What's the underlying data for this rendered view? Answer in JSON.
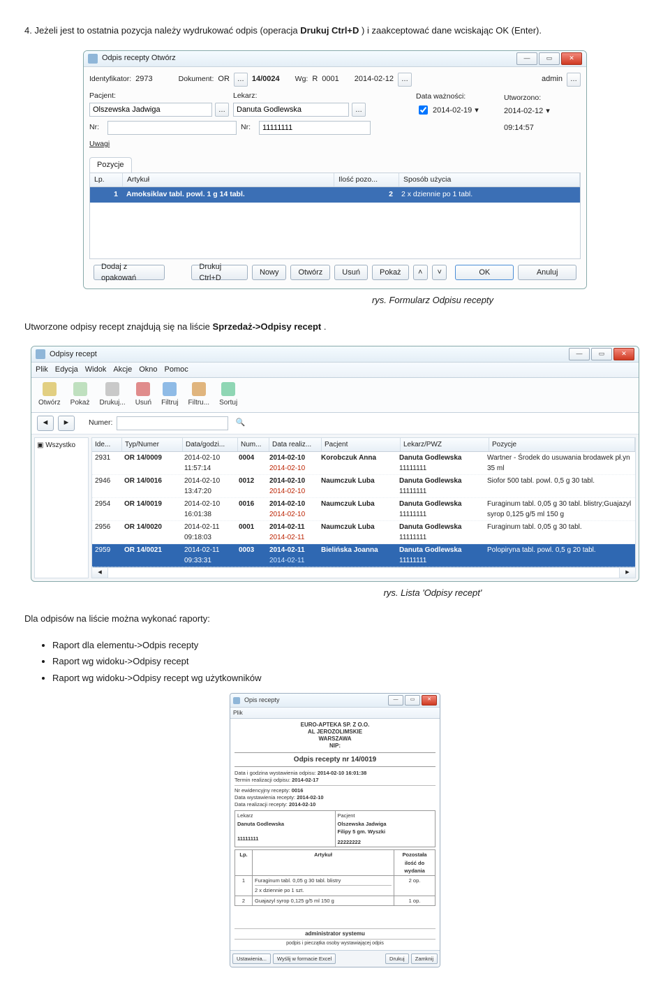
{
  "intro": {
    "prefix": "4. Jeżeli jest to ostatnia pozycja należy wydrukować odpis (operacja ",
    "op": "Drukuj Ctrl+D",
    "suffix": ") i zaakceptować dane wciskając OK (Enter)."
  },
  "form_window": {
    "title": "Odpis recepty Otwórz",
    "ident_label": "Identyfikator:",
    "ident_val": "2973",
    "dok_label": "Dokument:",
    "dok_type": "OR",
    "dok_num": "14/0024",
    "wg_label": "Wg:",
    "wg_type": "R",
    "wg_num": "0001",
    "wg_date": "2014-02-12",
    "user": "admin",
    "pacjent_lbl": "Pacjent:",
    "pacjent_val": "Olszewska Jadwiga",
    "lekarz_lbl": "Lekarz:",
    "lekarz_val": "Danuta Godlewska",
    "datawaz_lbl": "Data ważności:",
    "datawaz_val": "2014-02-19",
    "utw_lbl": "Utworzono:",
    "utw_date": "2014-02-12",
    "utw_time": "09:14:57",
    "nr_lbl": "Nr:",
    "nr_val": "11111111",
    "uwagi_lbl": "Uwagi",
    "poz_header": "Pozycje",
    "col_lp": "Lp.",
    "col_art": "Artykuł",
    "col_il": "Ilość pozo...",
    "col_sp": "Sposób użycia",
    "row_lp": "1",
    "row_art": "Amoksiklav tabl. powl. 1 g 14 tabl.",
    "row_il": "2",
    "row_sp": "2 x dziennie po 1 tabl.",
    "btns": {
      "dodaj": "Dodaj z opakowań",
      "drukuj": "Drukuj Ctrl+D",
      "nowy": "Nowy",
      "otworz": "Otwórz",
      "usun": "Usuń",
      "pokaz": "Pokaż",
      "ok": "OK",
      "anuluj": "Anuluj"
    }
  },
  "caption1": "rys. Formularz Odpisu recepty",
  "body2": {
    "prefix": "Utworzone odpisy recept znajdują się na liście ",
    "path": "Sprzedaż->Odpisy recept",
    "suffix": "."
  },
  "list_window": {
    "title": "Odpisy recept",
    "menu": [
      "Plik",
      "Edycja",
      "Widok",
      "Akcje",
      "Okno",
      "Pomoc"
    ],
    "tools": [
      "Otwórz",
      "Pokaż",
      "Drukuj...",
      "Usuń",
      "Filtruj",
      "Filtru...",
      "Sortuj"
    ],
    "nav_label": "Numer:",
    "tree_root": "Wszystko",
    "columns": [
      "Ide...",
      "Typ/Numer",
      "Data/godzi...",
      "Num...",
      "Data realiz...",
      "Pacjent",
      "Lekarz/PWZ",
      "Pozycje"
    ],
    "rows": [
      {
        "id": "2931",
        "tn": "OR 14/0009",
        "dg1": "2014-02-10",
        "dg2": "11:57:14",
        "num": "0004",
        "dr1": "2014-02-10",
        "dr2": "2014-02-10",
        "pac": "Korobczuk Anna",
        "lek": "Danuta Godlewska",
        "pwz": "11111111",
        "poz": "Wartner - Środek do usuwania brodawek pł.yn 35 ml"
      },
      {
        "id": "2946",
        "tn": "OR 14/0016",
        "dg1": "2014-02-10",
        "dg2": "13:47:20",
        "num": "0012",
        "dr1": "2014-02-10",
        "dr2": "2014-02-10",
        "pac": "Naumczuk Luba",
        "lek": "Danuta Godlewska",
        "pwz": "11111111",
        "poz": "Siofor 500 tabl. powl. 0,5 g 30 tabl."
      },
      {
        "id": "2954",
        "tn": "OR 14/0019",
        "dg1": "2014-02-10",
        "dg2": "16:01:38",
        "num": "0016",
        "dr1": "2014-02-10",
        "dr2": "2014-02-10",
        "pac": "Naumczuk Luba",
        "lek": "Danuta Godlewska",
        "pwz": "11111111",
        "poz": "Furaginum tabl. 0,05 g 30 tabl. blistry;Guajazyl syrop 0,125 g/5 ml 150 g"
      },
      {
        "id": "2956",
        "tn": "OR 14/0020",
        "dg1": "2014-02-11",
        "dg2": "09:18:03",
        "num": "0001",
        "dr1": "2014-02-11",
        "dr2": "2014-02-11",
        "pac": "Naumczuk Luba",
        "lek": "Danuta Godlewska",
        "pwz": "11111111",
        "poz": "Furaginum tabl. 0,05 g 30 tabl."
      },
      {
        "id": "2959",
        "tn": "OR 14/0021",
        "dg1": "2014-02-11",
        "dg2": "09:33:31",
        "num": "0003",
        "dr1": "2014-02-11",
        "dr2": "2014-02-11",
        "pac": "Bielińska Joanna",
        "lek": "Danuta Godlewska",
        "pwz": "11111111",
        "poz": "Polopiryna tabl. powl. 0,5 g 20 tabl."
      }
    ]
  },
  "caption2": "rys. Lista 'Odpisy recept'",
  "body3": "Dla odpisów na liście można wykonać raporty:",
  "bullets": [
    "Raport dla elementu->Odpis recepty",
    "Raport wg widoku->Odpisy recept",
    "Raport wg widoku->Odpisy recept wg użytkowników"
  ],
  "report": {
    "title": "Opis recepty",
    "menu": "Plik",
    "company1": "EURO-APTEKA SP. Z O.O.",
    "company2": "AL JEROZOLIMSKIE",
    "company3": "WARSZAWA",
    "nip": "NIP:",
    "heading": "Odpis recepty nr 14/0019",
    "l1_lbl": "Data i godzina wystawienia odpisu:",
    "l1_val": "2014-02-10   16:01:38",
    "l2_lbl": "Termin realizacji odpisu:",
    "l2_val": "2014-02-17",
    "l3_lbl": "Nr ewidencyjny recepty:",
    "l3_val": "0016",
    "l4_lbl": "Data wystawienia recepty:",
    "l4_val": "2014-02-10",
    "l5_lbl": "Data realizacji recepty:",
    "l5_val": "2014-02-10",
    "lek_lbl": "Lekarz",
    "lek_val": "Danuta Godlewska",
    "lek_pwz": "11111111",
    "pac_lbl": "Pacjent",
    "pac_val1": "Olszewska Jadwiga",
    "pac_val2": "Filipy 5 gm. Wyszki",
    "pac_nr": "22222222",
    "tbl_lp": "Lp.",
    "tbl_art": "Artykuł",
    "tbl_il": "Pozostała ilość do wydania",
    "r1_lp": "1",
    "r1_art": "Furaginum tabl. 0,05 g 30 tabl. blistry",
    "r1_note": "2 x dziennie po 1 szt.",
    "r1_il": "2 op.",
    "r2_lp": "2",
    "r2_art": "Guajazyl syrop 0,125 g/5 ml 150 g",
    "r2_il": "1 op.",
    "signer": "administrator systemu",
    "signer_note": "podpis i pieczątka osoby wystawiającej odpis",
    "btn1": "Ustawienia...",
    "btn2": "Wyślij w formacie Excel",
    "btn3": "Drukuj",
    "btn4": "Zamknij"
  }
}
